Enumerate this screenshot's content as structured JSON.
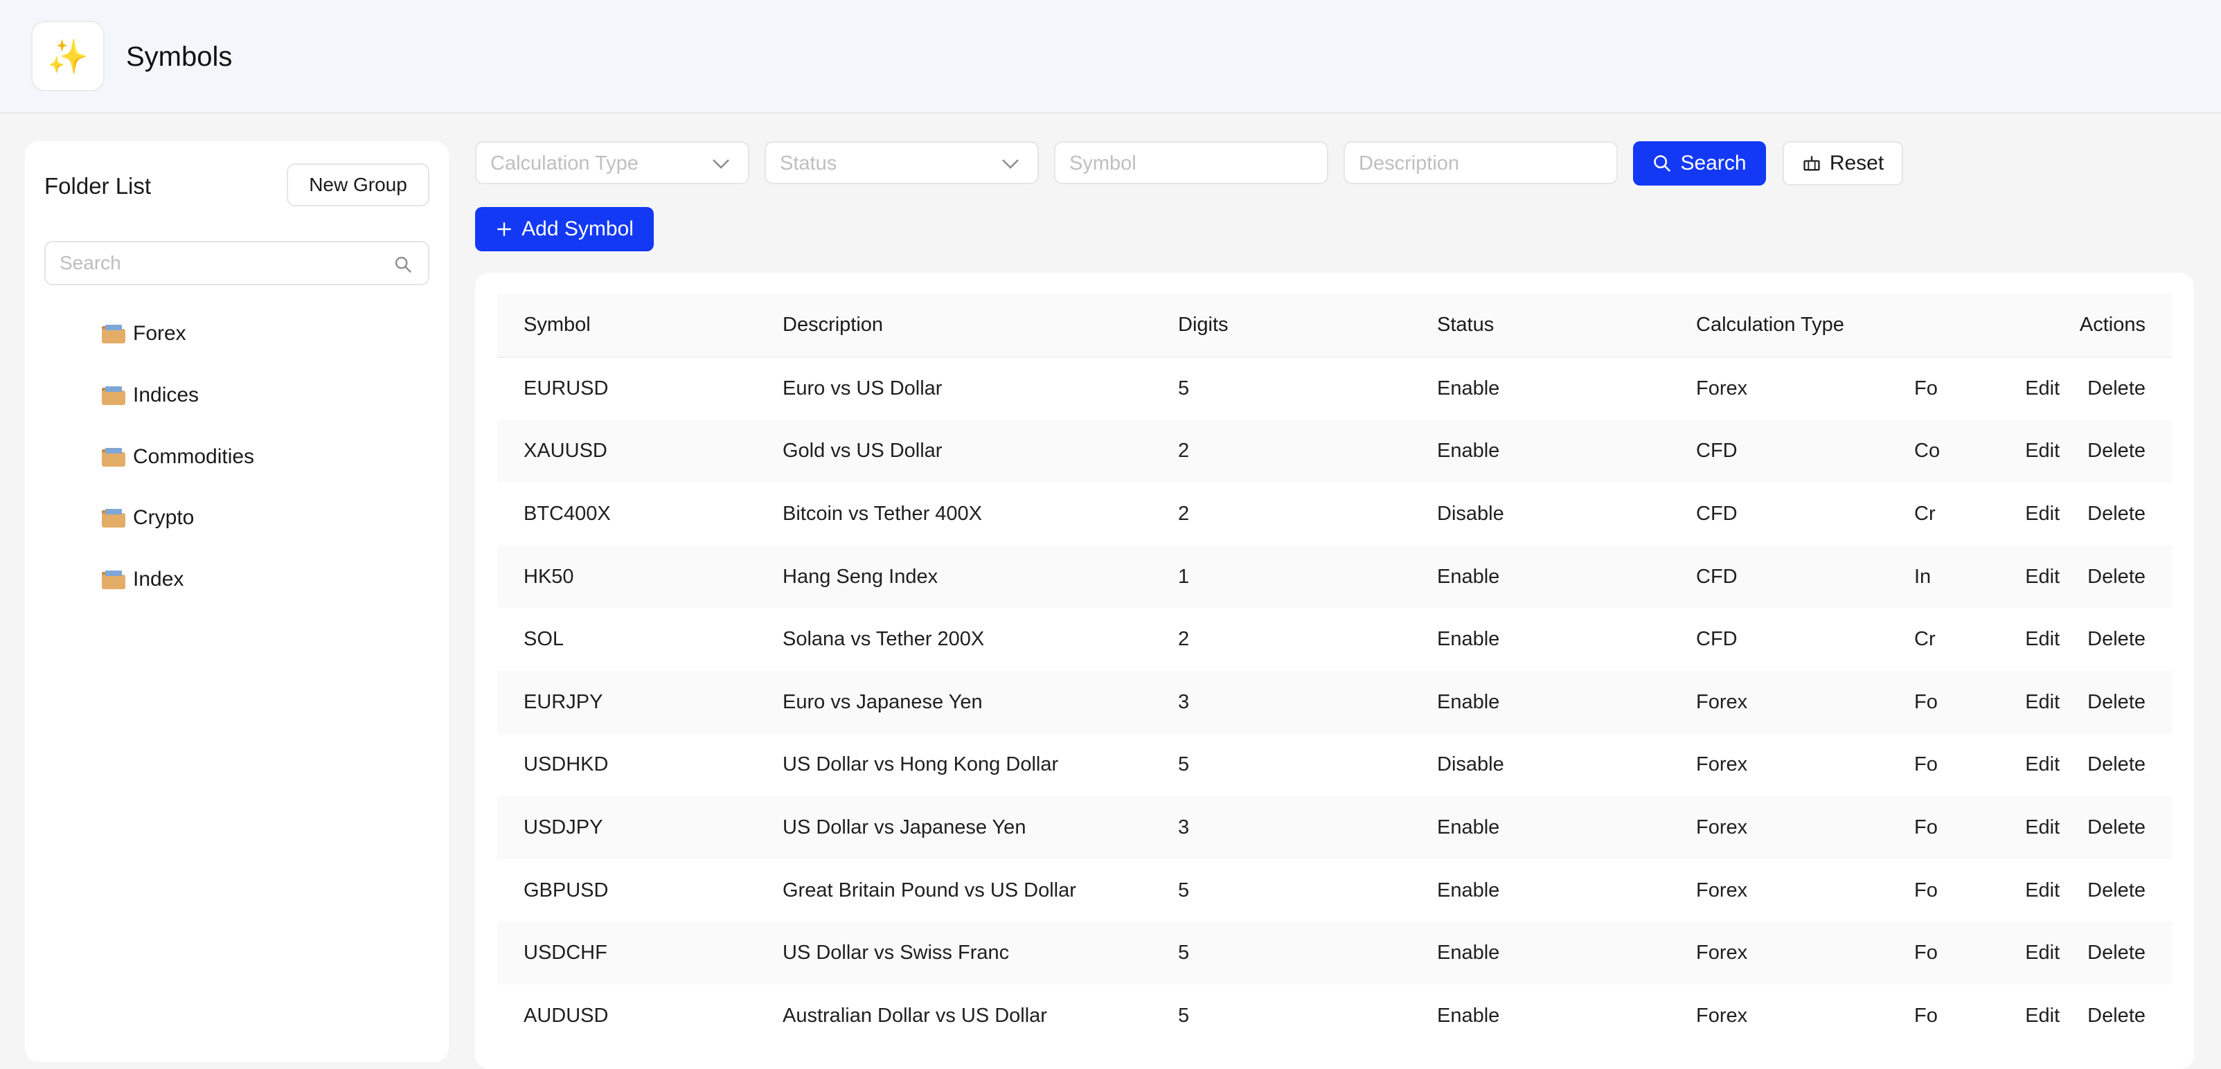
{
  "header": {
    "title": "Symbols",
    "logo": "✨"
  },
  "sidebar": {
    "title": "Folder List",
    "new_group_label": "New Group",
    "search_placeholder": "Search",
    "folders": [
      "Forex",
      "Indices",
      "Commodities",
      "Crypto",
      "Index"
    ]
  },
  "filters": {
    "calc_type_placeholder": "Calculation Type",
    "status_placeholder": "Status",
    "symbol_placeholder": "Symbol",
    "description_placeholder": "Description",
    "search_label": "Search",
    "reset_label": "Reset",
    "add_symbol_label": "Add Symbol"
  },
  "table": {
    "columns": [
      "Symbol",
      "Description",
      "Digits",
      "Status",
      "Calculation Type",
      "Actions"
    ],
    "edit_label": "Edit",
    "delete_label": "Delete",
    "rows": [
      {
        "symbol": "EURUSD",
        "description": "Euro vs US Dollar",
        "digits": "5",
        "status": "Enable",
        "calc_type": "Forex",
        "group_peek": "Fo"
      },
      {
        "symbol": "XAUUSD",
        "description": "Gold vs US Dollar",
        "digits": "2",
        "status": "Enable",
        "calc_type": "CFD",
        "group_peek": "Co"
      },
      {
        "symbol": "BTC400X",
        "description": "Bitcoin vs Tether 400X",
        "digits": "2",
        "status": "Disable",
        "calc_type": "CFD",
        "group_peek": "Cr"
      },
      {
        "symbol": "HK50",
        "description": "Hang Seng Index",
        "digits": "1",
        "status": "Enable",
        "calc_type": "CFD",
        "group_peek": "In"
      },
      {
        "symbol": "SOL",
        "description": "Solana vs Tether 200X",
        "digits": "2",
        "status": "Enable",
        "calc_type": "CFD",
        "group_peek": "Cr"
      },
      {
        "symbol": "EURJPY",
        "description": "Euro vs Japanese Yen",
        "digits": "3",
        "status": "Enable",
        "calc_type": "Forex",
        "group_peek": "Fo"
      },
      {
        "symbol": "USDHKD",
        "description": "US Dollar vs Hong Kong Dollar",
        "digits": "5",
        "status": "Disable",
        "calc_type": "Forex",
        "group_peek": "Fo"
      },
      {
        "symbol": "USDJPY",
        "description": "US Dollar vs Japanese Yen",
        "digits": "3",
        "status": "Enable",
        "calc_type": "Forex",
        "group_peek": "Fo"
      },
      {
        "symbol": "GBPUSD",
        "description": "Great Britain Pound vs US Dollar",
        "digits": "5",
        "status": "Enable",
        "calc_type": "Forex",
        "group_peek": "Fo"
      },
      {
        "symbol": "USDCHF",
        "description": "US Dollar vs Swiss Franc",
        "digits": "5",
        "status": "Enable",
        "calc_type": "Forex",
        "group_peek": "Fo"
      },
      {
        "symbol": "AUDUSD",
        "description": "Australian Dollar vs US Dollar",
        "digits": "5",
        "status": "Enable",
        "calc_type": "Forex",
        "group_peek": "Fo"
      }
    ]
  },
  "colors": {
    "primary": "#1339f5",
    "folder": "#d9a05b"
  }
}
